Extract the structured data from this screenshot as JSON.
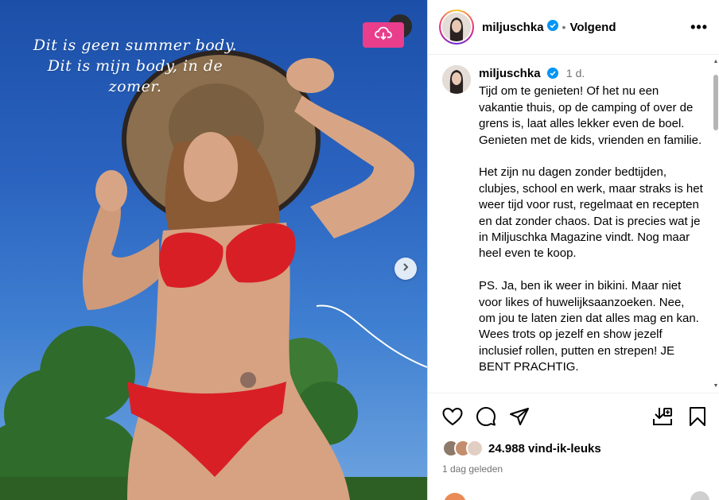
{
  "media": {
    "overlay_text": "Dit is geen summer body. Dit is mijn body, in de zomer."
  },
  "header": {
    "username": "miljuschka",
    "separator": "•",
    "follow_label": "Volgend",
    "more_label": "•••"
  },
  "caption": {
    "username": "miljuschka",
    "time": "1 d.",
    "paragraphs": [
      "Tijd om te genieten! Of het nu een vakantie thuis, op de camping of over de grens is, laat alles lekker even de boel. Genieten met de kids, vrienden en familie.",
      "Het zijn nu dagen zonder bedtijden, clubjes, school en werk, maar straks is het weer tijd voor rust, regelmaat en recepten en dat zonder chaos. Dat is precies wat je in Miljuschka Magazine vindt. Nog maar heel even te koop.",
      "PS. Ja, ben ik weer in bikini. Maar niet voor likes of huwelijksaanzoeken. Nee, om jou te laten zien dat alles mag en kan. Wees trots op jezelf en show jezelf inclusief rollen, putten en strepen! JE BENT PRACHTIG."
    ]
  },
  "engagement": {
    "likes": "24.988 vind-ik-leuks",
    "posted": "1 dag geleden"
  },
  "icons": {
    "like": "heart-icon",
    "comment": "comment-icon",
    "share": "send-icon",
    "download": "download-icon",
    "save": "bookmark-icon"
  },
  "colors": {
    "accent_pink": "#e83e8c",
    "verified_blue": "#0095f6",
    "bikini_red": "#d91f26",
    "sky_blue": "#2a63bf"
  }
}
